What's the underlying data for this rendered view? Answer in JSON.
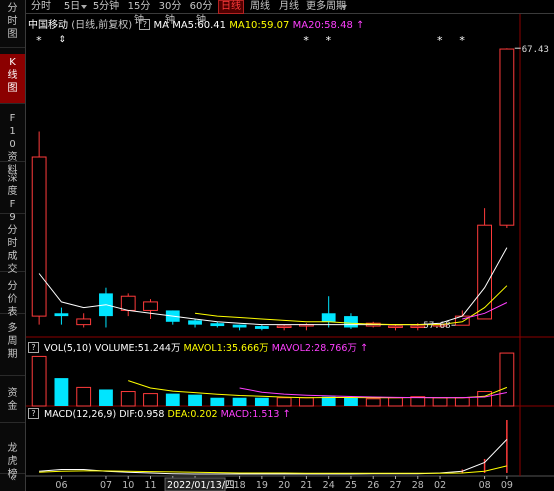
{
  "tabs": [
    {
      "label": "分时",
      "active": false
    },
    {
      "label": "5日",
      "active": false,
      "dropdown": true
    },
    {
      "label": "5分钟",
      "active": false
    },
    {
      "label": "15分钟",
      "active": false
    },
    {
      "label": "30分钟",
      "active": false
    },
    {
      "label": "60分钟",
      "active": false
    },
    {
      "label": "日线",
      "active": true
    },
    {
      "label": "周线",
      "active": false
    },
    {
      "label": "月线",
      "active": false
    },
    {
      "label": "更多周期",
      "active": false,
      "dropdown": true
    }
  ],
  "sidebar": [
    {
      "label": "分时图",
      "active": false
    },
    {
      "label": "K线图",
      "active": true
    },
    {
      "label": "F10资料",
      "active": false
    },
    {
      "label": "深度F9",
      "active": false
    },
    {
      "label": "分时成交",
      "active": false
    },
    {
      "label": "分价表",
      "active": false
    },
    {
      "label": "多周期",
      "active": false
    },
    {
      "label": "资金",
      "active": false
    },
    {
      "label": "龙虎榜",
      "active": false
    }
  ],
  "stock": {
    "name": "中国移动",
    "subtitle": "(日线,前复权)",
    "help_mark": "?",
    "ma_label": "MA",
    "ma5": "MA5:60.41",
    "ma10": "MA10:59.07",
    "ma20": "MA20:58.48"
  },
  "vol": {
    "title": "VOL(5,10)",
    "volume": "VOLUME:51.244万",
    "mavol1": "MAVOL1:35.666万",
    "mavol2": "MAVOL2:28.766万"
  },
  "macd": {
    "title": "MACD(12,26,9)",
    "dif": "DIF:0.958",
    "dea": "DEA:0.202",
    "macd": "MACD:1.513"
  },
  "markers": {
    "high_price": "67.43",
    "low_price": "57.68",
    "star": "*",
    "arrow": "⇕"
  },
  "chart_data": {
    "type": "candlestick",
    "x_tick_labels": [
      "06",
      "07",
      "10",
      "11",
      "12",
      "2022/01/13/四",
      "18",
      "19",
      "20",
      "21",
      "24",
      "25",
      "26",
      "27",
      "28",
      "02",
      "08",
      "09"
    ],
    "candles": [
      {
        "open": 58.0,
        "close": 63.6,
        "high": 64.5,
        "low": 57.7,
        "dir": "up"
      },
      {
        "open": 58.1,
        "close": 58.0,
        "high": 58.3,
        "low": 57.7,
        "dir": "down"
      },
      {
        "open": 57.7,
        "close": 57.9,
        "high": 58.1,
        "low": 57.6,
        "dir": "up"
      },
      {
        "open": 58.8,
        "close": 58.0,
        "high": 59.0,
        "low": 57.6,
        "dir": "down"
      },
      {
        "open": 58.2,
        "close": 58.7,
        "high": 58.8,
        "low": 58.0,
        "dir": "up"
      },
      {
        "open": 58.2,
        "close": 58.5,
        "high": 58.6,
        "low": 57.9,
        "dir": "up"
      },
      {
        "open": 58.2,
        "close": 57.8,
        "high": 58.2,
        "low": 57.7,
        "dir": "down"
      },
      {
        "open": 57.85,
        "close": 57.7,
        "high": 57.9,
        "low": 57.6,
        "dir": "down"
      },
      {
        "open": 57.75,
        "close": 57.65,
        "high": 57.8,
        "low": 57.6,
        "dir": "down"
      },
      {
        "open": 57.7,
        "close": 57.6,
        "high": 57.7,
        "low": 57.5,
        "dir": "down"
      },
      {
        "open": 57.65,
        "close": 57.55,
        "high": 57.7,
        "low": 57.5,
        "dir": "down"
      },
      {
        "open": 57.6,
        "close": 57.65,
        "high": 57.7,
        "low": 57.5,
        "dir": "up"
      },
      {
        "open": 57.65,
        "close": 57.7,
        "high": 57.75,
        "low": 57.5,
        "dir": "up"
      },
      {
        "open": 58.1,
        "close": 57.8,
        "high": 58.7,
        "low": 57.6,
        "dir": "down"
      },
      {
        "open": 58.0,
        "close": 57.6,
        "high": 58.1,
        "low": 57.55,
        "dir": "down"
      },
      {
        "open": 57.65,
        "close": 57.75,
        "high": 57.8,
        "low": 57.6,
        "dir": "up"
      },
      {
        "open": 57.6,
        "close": 57.65,
        "high": 57.7,
        "low": 57.5,
        "dir": "up"
      },
      {
        "open": 57.6,
        "close": 57.65,
        "high": 57.75,
        "low": 57.5,
        "dir": "up"
      },
      {
        "open": 57.65,
        "close": 57.7,
        "high": 57.75,
        "low": 57.6,
        "dir": "up"
      },
      {
        "open": 57.68,
        "close": 58.0,
        "high": 58.2,
        "low": 57.68,
        "dir": "up"
      },
      {
        "open": 57.9,
        "close": 61.2,
        "high": 61.8,
        "low": 57.9,
        "dir": "up"
      },
      {
        "open": 61.2,
        "close": 67.4,
        "high": 67.43,
        "low": 61.1,
        "dir": "up"
      }
    ],
    "ma5": [
      59.5,
      58.5,
      58.3,
      58.4,
      58.2,
      58.1,
      58.0,
      57.9,
      57.8,
      57.75,
      57.7,
      57.7,
      57.7,
      57.7,
      57.7,
      57.7,
      57.7,
      57.7,
      57.75,
      58.0,
      59.0,
      60.41
    ],
    "ma10": [
      null,
      null,
      null,
      null,
      null,
      null,
      null,
      58.1,
      58.0,
      57.95,
      57.9,
      57.85,
      57.8,
      57.8,
      57.75,
      57.72,
      57.7,
      57.7,
      57.7,
      57.8,
      58.3,
      59.07
    ],
    "ma20": [
      null,
      null,
      null,
      null,
      null,
      null,
      null,
      null,
      null,
      null,
      null,
      null,
      null,
      null,
      null,
      null,
      null,
      null,
      null,
      57.9,
      58.1,
      58.48
    ],
    "volume": [
      48,
      27,
      18,
      16,
      14,
      12,
      12,
      11,
      8,
      8,
      8,
      8,
      8,
      9,
      8,
      7,
      8,
      9,
      8,
      8,
      14,
      51.244
    ],
    "macd_hist": [
      0,
      0,
      0,
      0,
      0,
      0,
      0,
      0,
      0,
      0,
      0,
      0,
      0,
      0,
      0,
      0,
      0,
      0,
      0,
      0.1,
      0.4,
      1.513
    ],
    "dif": [
      0.05,
      0.1,
      0.1,
      0.05,
      0.02,
      0.0,
      -0.02,
      -0.03,
      -0.03,
      -0.03,
      -0.03,
      -0.03,
      -0.03,
      -0.03,
      -0.03,
      -0.02,
      -0.02,
      -0.02,
      0.0,
      0.05,
      0.3,
      0.958
    ],
    "dea": [
      0.02,
      0.05,
      0.06,
      0.06,
      0.05,
      0.04,
      0.03,
      0.02,
      0.01,
      0.0,
      0.0,
      0.0,
      -0.01,
      -0.01,
      -0.01,
      -0.01,
      -0.01,
      -0.01,
      -0.01,
      0.0,
      0.05,
      0.202
    ],
    "price_range": [
      57.3,
      68.0
    ],
    "colors": {
      "up": "#ff3b3b",
      "down": "#00e5ff",
      "ma5": "#ffffff",
      "ma10": "#ffff00",
      "ma20": "#ff40ff",
      "grid": "#8b0000",
      "axis": "#aaaaaa"
    }
  }
}
